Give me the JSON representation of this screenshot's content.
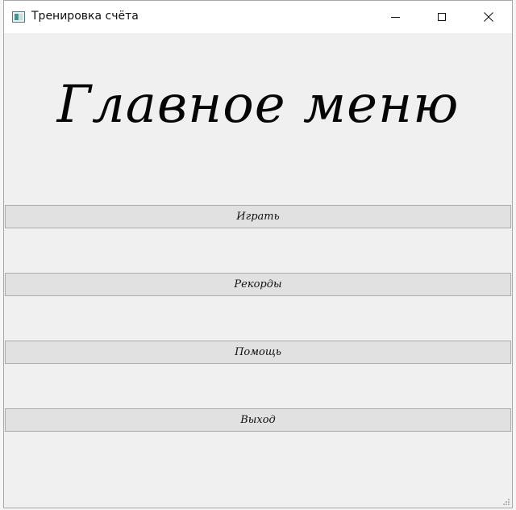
{
  "window": {
    "title": "Тренировка счёта"
  },
  "icons": {
    "app": "app-icon",
    "minimize": "minimize-icon",
    "maximize": "maximize-icon",
    "close": "close-icon",
    "grip": "resize-grip-icon"
  },
  "main": {
    "heading": "Главное меню",
    "buttons": [
      {
        "label": "Играть"
      },
      {
        "label": "Рекорды"
      },
      {
        "label": "Помощь"
      },
      {
        "label": "Выход"
      }
    ]
  }
}
